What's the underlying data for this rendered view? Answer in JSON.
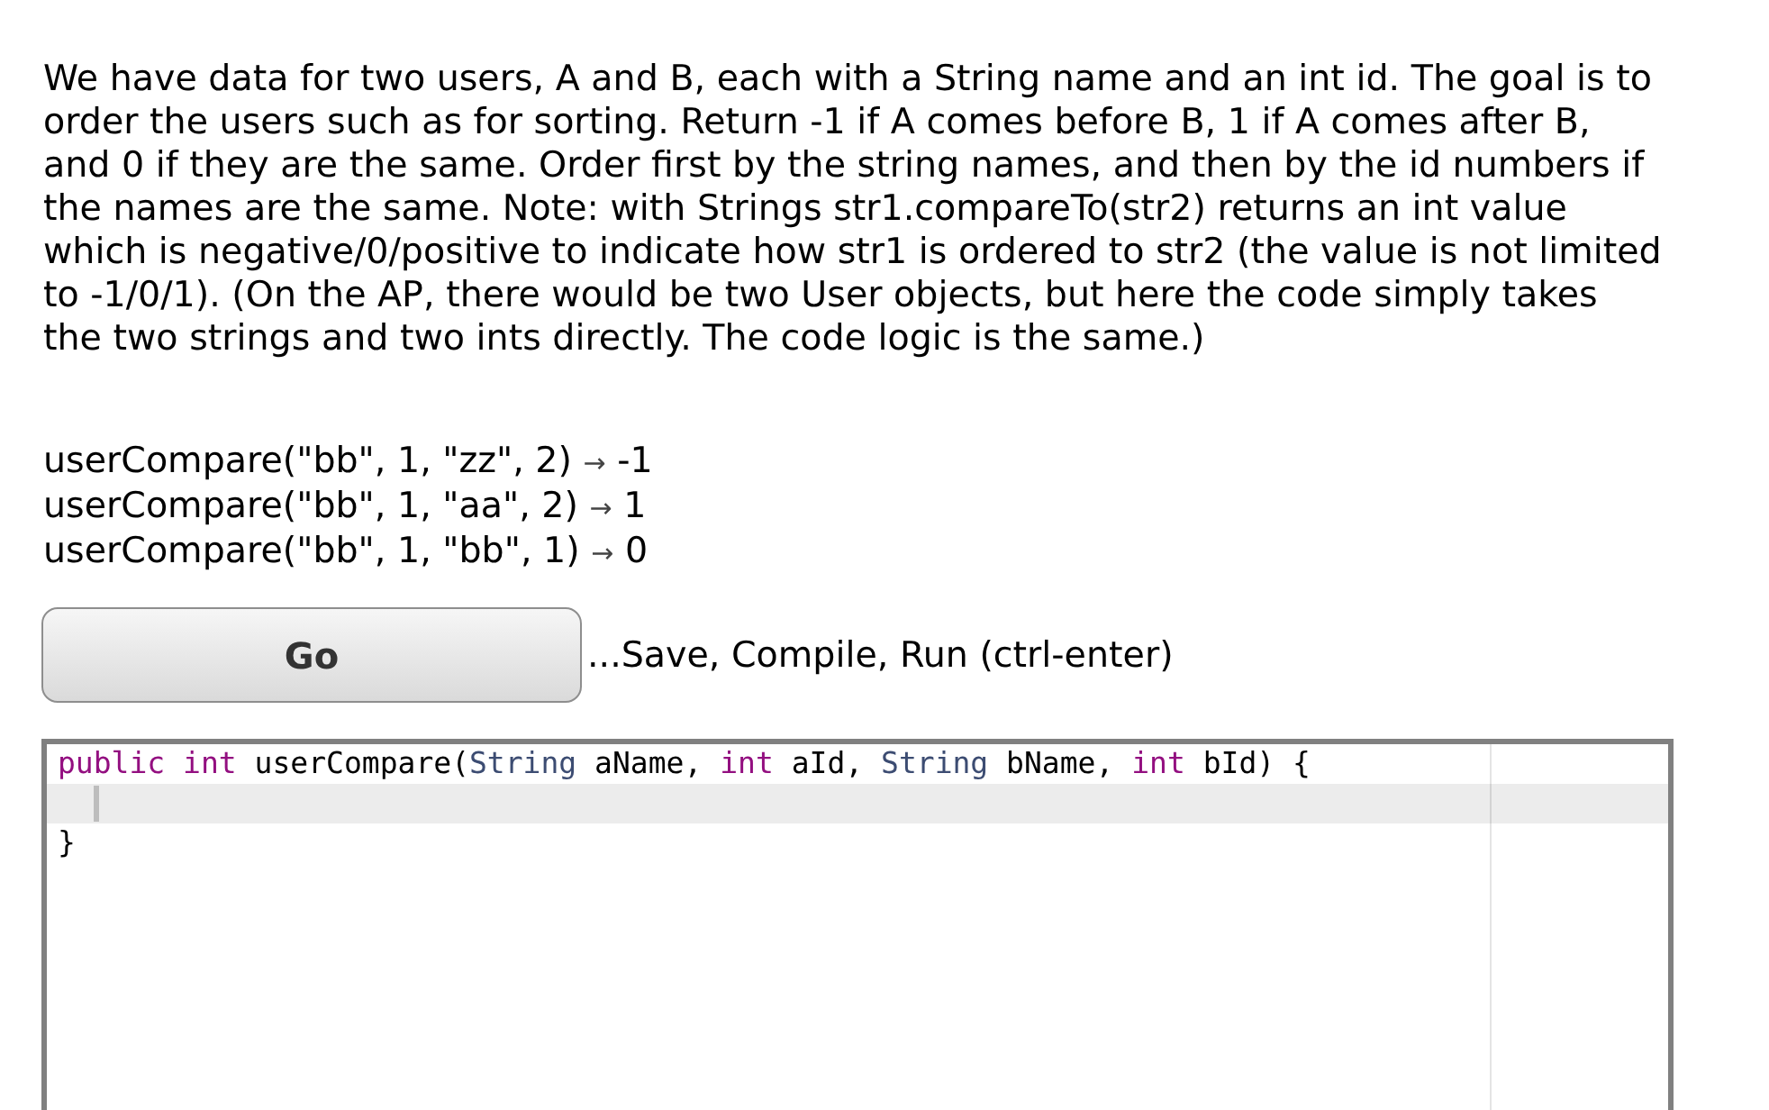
{
  "description": "We have data for two users, A and B, each with a String name and an int id. The goal is to order the users such as for sorting. Return -1 if A comes before B, 1 if A comes after B, and 0 if they are the same. Order first by the string names, and then by the id numbers if the names are the same. Note: with Strings str1.compareTo(str2) returns an int value which is negative/0/positive to indicate how str1 is ordered to str2 (the value is not limited to -1/0/1). (On the AP, there would be two User objects, but here the code simply takes the two strings and two ints directly. The code logic is the same.)",
  "examples": [
    {
      "call": "userCompare(\"bb\", 1, \"zz\", 2)",
      "arrow": "→",
      "result": "-1"
    },
    {
      "call": "userCompare(\"bb\", 1, \"aa\", 2)",
      "arrow": "→",
      "result": "1"
    },
    {
      "call": "userCompare(\"bb\", 1, \"bb\", 1)",
      "arrow": "→",
      "result": "0"
    }
  ],
  "run": {
    "button": "Go",
    "hint": "...Save, Compile, Run (ctrl-enter)"
  },
  "editor": {
    "lines": [
      {
        "active": false,
        "tokens": [
          {
            "kind": "keyword",
            "text": "public "
          },
          {
            "kind": "keyword",
            "text": "int"
          },
          {
            "kind": "plain",
            "text": " userCompare("
          },
          {
            "kind": "type",
            "text": "String"
          },
          {
            "kind": "plain",
            "text": " aName, "
          },
          {
            "kind": "keyword",
            "text": "int"
          },
          {
            "kind": "plain",
            "text": " aId, "
          },
          {
            "kind": "type",
            "text": "String"
          },
          {
            "kind": "plain",
            "text": " bName, "
          },
          {
            "kind": "keyword",
            "text": "int"
          },
          {
            "kind": "plain",
            "text": " bId) {"
          }
        ]
      },
      {
        "active": true
      },
      {
        "active": false,
        "tokens": [
          {
            "kind": "plain",
            "text": "}"
          }
        ]
      }
    ]
  }
}
